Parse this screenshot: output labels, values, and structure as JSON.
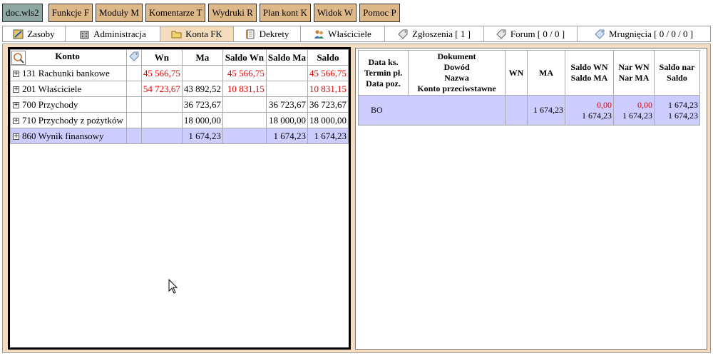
{
  "menu": {
    "items": [
      "doc.wls2",
      "Funkcje F",
      "Moduły M",
      "Komentarze T",
      "Wydruki R",
      "Plan kont K",
      "Widok W",
      "Pomoc P"
    ]
  },
  "tabs": [
    {
      "label": "Zasoby",
      "icon": "resources-icon"
    },
    {
      "label": "Administracja",
      "icon": "building-icon"
    },
    {
      "label": "Konta FK",
      "icon": "folder-icon"
    },
    {
      "label": "Dekrety",
      "icon": "document-icon"
    },
    {
      "label": "Właściciele",
      "icon": "users-icon"
    },
    {
      "label": "Zgłoszenia [ 1 ]",
      "icon": "tag-icon"
    },
    {
      "label": "Forum [ 0 / 0 ]",
      "icon": "tag-icon"
    },
    {
      "label": "Mrugnięcia [ 0 / 0 / 0 ]",
      "icon": "tag-icon"
    }
  ],
  "accounts": {
    "headers": {
      "konto": "Konto",
      "wn": "Wn",
      "ma": "Ma",
      "saldo_wn": "Saldo Wn",
      "saldo_ma": "Saldo Ma",
      "saldo": "Saldo"
    },
    "rows": [
      {
        "name": "131 Rachunki bankowe",
        "wn": "45 566,75",
        "ma": "",
        "saldo_wn": "45 566,75",
        "saldo_ma": "",
        "saldo": "45 566,75",
        "red": true
      },
      {
        "name": "201 Właściciele",
        "wn": "54 723,67",
        "ma": "43 892,52",
        "saldo_wn": "10 831,15",
        "saldo_ma": "",
        "saldo": "10 831,15",
        "red": true
      },
      {
        "name": "700 Przychody",
        "wn": "",
        "ma": "36 723,67",
        "saldo_wn": "",
        "saldo_ma": "36 723,67",
        "saldo": "36 723,67",
        "red": false
      },
      {
        "name": "710 Przychody z pożytków",
        "wn": "",
        "ma": "18 000,00",
        "saldo_wn": "",
        "saldo_ma": "18 000,00",
        "saldo": "18 000,00",
        "red": false
      },
      {
        "name": "860 Wynik finansowy",
        "wn": "",
        "ma": "1 674,23",
        "saldo_wn": "",
        "saldo_ma": "1 674,23",
        "saldo": "1 674,23",
        "red": false,
        "selected": true
      }
    ]
  },
  "details": {
    "headers": {
      "date": [
        "Data ks.",
        "Termin pł.",
        "Data poz."
      ],
      "doc": [
        "Dokument",
        "Dowód",
        "Nazwa",
        "Konto przeciwstawne"
      ],
      "wn": "WN",
      "ma": "MA",
      "saldo": [
        "Saldo WN",
        "Saldo MA"
      ],
      "nar": [
        "Nar WN",
        "Nar MA"
      ],
      "saldo_nar": [
        "Saldo nar",
        "Saldo"
      ]
    },
    "row": {
      "label": "BO",
      "wn": "",
      "ma": "1 674,23",
      "saldo_wn": "0,00",
      "saldo_ma": "1 674,23",
      "nar_wn": "0,00",
      "nar_ma": "1 674,23",
      "saldo_nar": "1 674,23",
      "saldo2": "1 674,23"
    }
  },
  "colors": {
    "menu": "#dfb88a",
    "menu_active": "#8fa8a3",
    "frame": "#f3dcbf",
    "selected_row": "#ccccff",
    "negative": "#e00000"
  }
}
